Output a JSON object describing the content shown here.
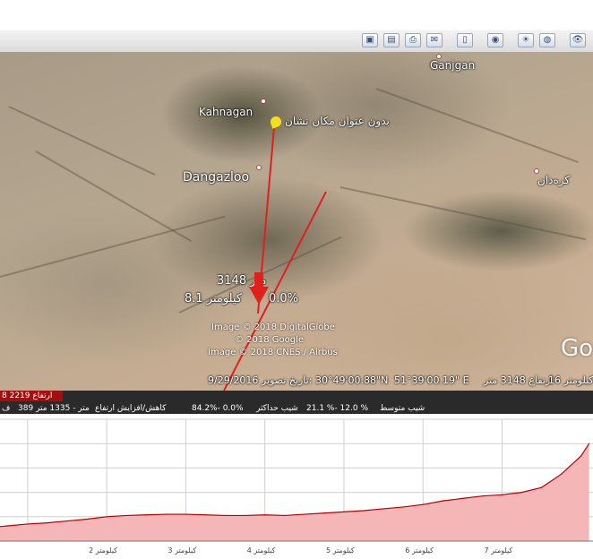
{
  "toolbar": {
    "icons": [
      "photo-icon",
      "document-icon",
      "print-icon",
      "email-icon",
      "sidebar-icon",
      "planet-icon",
      "sun-icon",
      "earth-icon",
      "view-icon"
    ]
  },
  "map": {
    "places": {
      "ganjgan": "Ganjgan",
      "kahnagan": "Kahnagan",
      "dangazloo": "Dangazloo",
      "pin_label": "بدون عنوان مکان نشان",
      "karvan": "کره‌دان"
    },
    "elevation_label": "3148 متر",
    "distance_label": "8.1 کیلومتر",
    "slope_label": "0.0%",
    "watermark": {
      "line1": "Image © 2018 DigitalGlobe",
      "line2": "© 2018 Google",
      "line3": "Image © 2018 CNES / Airbus"
    },
    "google_logo": "Go",
    "status": {
      "imagery_date": "9/29/2016 تاریخ تصویر:",
      "lat": "30°49'00.88\"N",
      "lon": "51°39'00.19\" E",
      "elevation": "ارتفاع 3148 متر",
      "eye_alt": "16 کیلومتر"
    }
  },
  "info": {
    "red_label": "8 2219 ارتفاع",
    "stats": {
      "left": "ف",
      "range": "389 متر - 1335 متر",
      "gain_loss": "کاهش/افزایش ارتفاع",
      "max_slope": "84.2%- 0.0%",
      "max_slope_label": "شیب حداکثر",
      "avg_slope": "21.1 %- 12.0 %",
      "avg_slope_label": "شیب متوسط"
    }
  },
  "chart_data": {
    "type": "area",
    "x": [
      0,
      0.25,
      0.5,
      0.75,
      1,
      1.25,
      1.5,
      1.75,
      2,
      2.25,
      2.5,
      2.75,
      3,
      3.25,
      3.5,
      3.75,
      4,
      4.25,
      4.5,
      4.75,
      5,
      5.25,
      5.5,
      5.75,
      6,
      6.25,
      6.5,
      6.75,
      7,
      7.25,
      7.5,
      7.75,
      8,
      8.1
    ],
    "values": [
      18,
      20,
      22,
      25,
      28,
      30,
      33,
      36,
      40,
      42,
      43,
      44,
      44,
      43,
      42,
      42,
      43,
      42,
      44,
      46,
      48,
      50,
      53,
      56,
      60,
      66,
      70,
      74,
      76,
      80,
      88,
      110,
      140,
      160
    ],
    "x_ticks": [
      {
        "x": 2,
        "label": "2 کیلومتر"
      },
      {
        "x": 3,
        "label": "3 کیلومتر"
      },
      {
        "x": 4,
        "label": "4 کیلومتر"
      },
      {
        "x": 5,
        "label": "5 کیلومتر"
      },
      {
        "x": 6,
        "label": "6 کیلومتر"
      },
      {
        "x": 7,
        "label": "7 کیلومتر"
      }
    ],
    "xlim": [
      0.65,
      8.15
    ],
    "ylim": [
      0,
      200
    ],
    "fill_color": "#f4b6b6",
    "line_color": "#b50000",
    "grid": true
  }
}
